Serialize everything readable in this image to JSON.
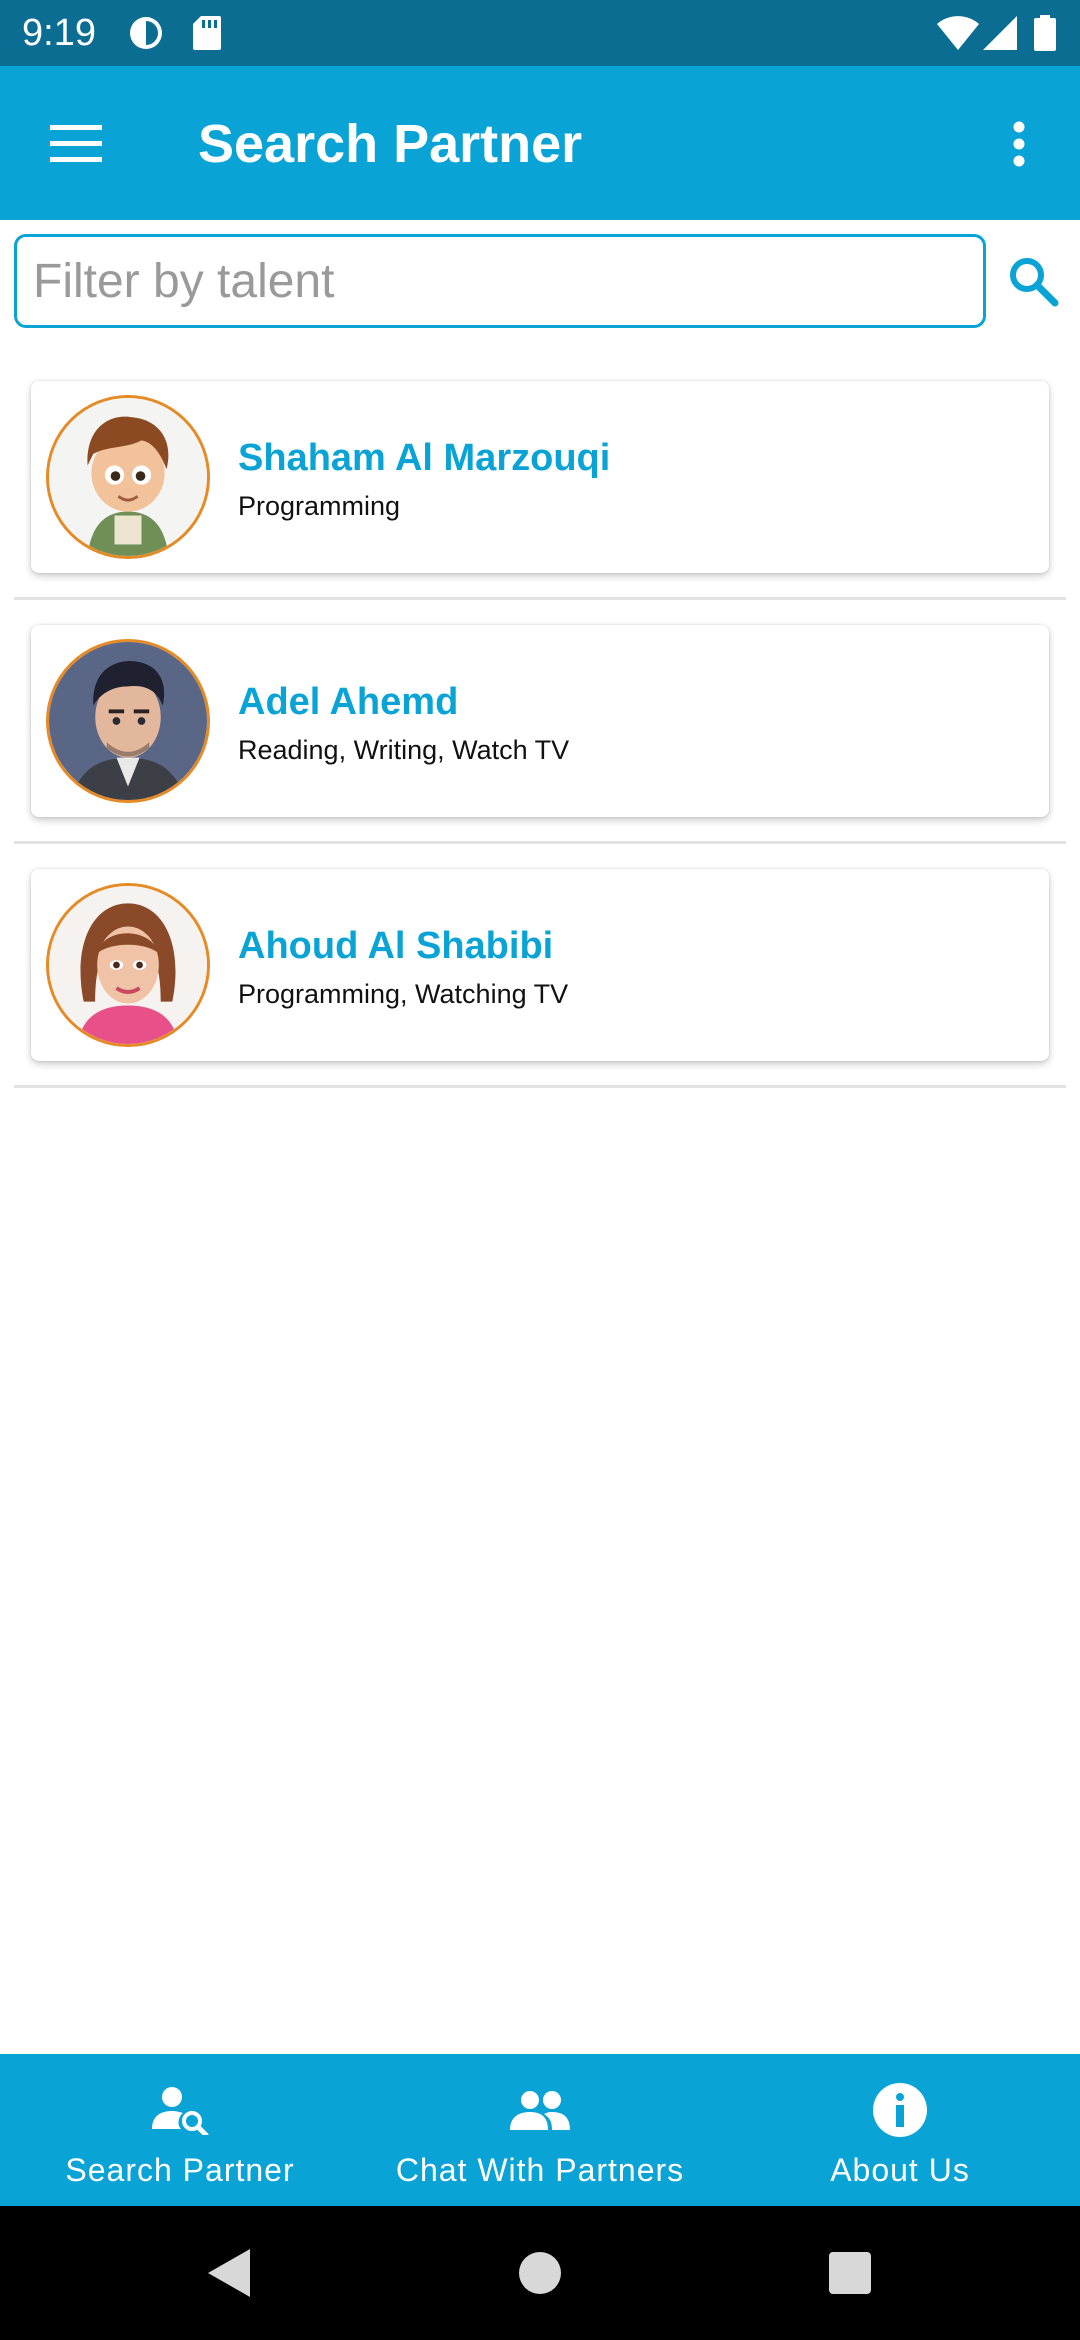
{
  "status_bar": {
    "time": "9:19",
    "icons": [
      "data-saver-icon",
      "sd-card-icon",
      "wifi-icon",
      "signal-icon",
      "battery-icon"
    ]
  },
  "app_bar": {
    "title": "Search Partner",
    "menu_icon": "hamburger-menu-icon",
    "overflow_icon": "more-vertical-icon"
  },
  "search": {
    "placeholder": "Filter by talent",
    "value": "",
    "icon": "search-icon"
  },
  "partners": [
    {
      "name": "Shaham Al Marzouqi",
      "talent": "Programming",
      "avatar": "cartoon-boy-avatar"
    },
    {
      "name": "Adel Ahemd",
      "talent": "Reading, Writing, Watch TV",
      "avatar": "cartoon-man-avatar"
    },
    {
      "name": "Ahoud Al Shabibi",
      "talent": "Programming, Watching TV",
      "avatar": "cartoon-woman-avatar"
    }
  ],
  "bottom_nav": {
    "items": [
      {
        "label": "Search Partner",
        "icon": "person-search-icon"
      },
      {
        "label": "Chat With Partners",
        "icon": "people-icon"
      },
      {
        "label": "About Us",
        "icon": "info-icon"
      }
    ]
  },
  "colors": {
    "status_bar": "#0a6d91",
    "primary": "#0aa3d6",
    "avatar_border": "#e58a25",
    "divider": "#e2e2e2"
  }
}
